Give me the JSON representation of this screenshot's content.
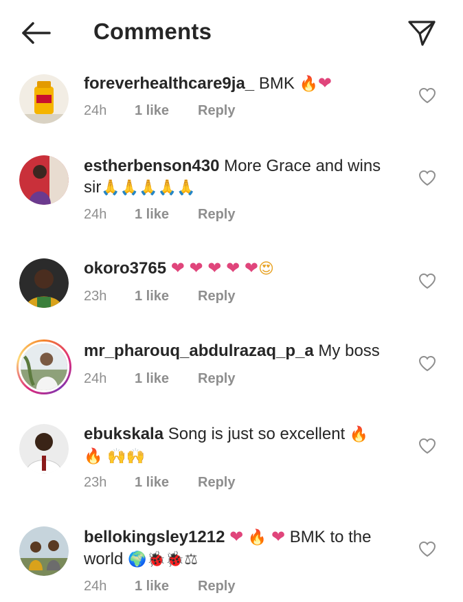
{
  "header": {
    "title": "Comments"
  },
  "comments": [
    {
      "username": "foreverhealthcare9ja_",
      "text": " BMK ",
      "emojis": [
        "🔥",
        "❤"
      ],
      "time": "24h",
      "likes": "1 like",
      "reply": "Reply"
    },
    {
      "username": "estherbenson430",
      "text": " More Grace and wins sir",
      "emojis": [
        "🙏",
        "🙏",
        "🙏",
        "🙏",
        "🙏"
      ],
      "time": "24h",
      "likes": "1 like",
      "reply": "Reply"
    },
    {
      "username": "okoro3765",
      "text": " ",
      "emojis": [
        "❤",
        "❤",
        "❤",
        "❤",
        "❤",
        "😍"
      ],
      "time": "23h",
      "likes": "1 like",
      "reply": "Reply"
    },
    {
      "username": "mr_pharouq_abdulrazaq_p_a",
      "text": " My boss",
      "emojis": [],
      "time": "24h",
      "likes": "1 like",
      "reply": "Reply"
    },
    {
      "username": "ebukskala",
      "text": " Song is just so excellent ",
      "emojis": [
        "🔥",
        "🔥",
        "🙌",
        "🙌"
      ],
      "time": "23h",
      "likes": "1 like",
      "reply": "Reply"
    },
    {
      "username": "bellokingsley1212",
      "text": " BMK to the world ",
      "emojis": [
        "❤",
        "🔥",
        "❤",
        "🌍",
        "🐞",
        "🐞",
        "⚖"
      ],
      "time": "24h",
      "likes": "1 like",
      "reply": "Reply"
    }
  ]
}
